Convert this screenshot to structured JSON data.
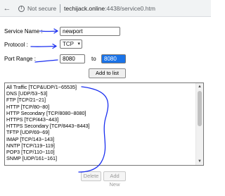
{
  "browser": {
    "security_text": "Not secure",
    "url_host": "techijack.online",
    "url_rest": ":4438/service0.htm",
    "icons": {
      "back": "back-arrow-icon",
      "warning": "info-warning-icon"
    }
  },
  "form": {
    "service_name_label": "Service Name :",
    "service_name_value": "newport",
    "protocol_label": "Protocol :",
    "protocol_value": "TCP",
    "port_range_label": "Port Range :",
    "port_start": "8080",
    "port_to_label": "to",
    "port_end": "8080",
    "add_button": "Add to list"
  },
  "service_list": [
    "All Traffic [TCP&UDP/1~65535]",
    "DNS [UDP/53~53]",
    "FTP [TCP/21~21]",
    "HTTP [TCP/80~80]",
    "HTTP Secondary [TCP/8080~8080]",
    "HTTPS [TCP/443~443]",
    "HTTPS Secondary [TCP/8443~8443]",
    "TFTP [UDP/69~69]",
    "IMAP [TCP/143~143]",
    "NNTP [TCP/119~119]",
    "POP3 [TCP/110~110]",
    "SNMP [UDP/161~161]"
  ],
  "list_actions": {
    "delete": "Delete",
    "add_new": "Add New"
  },
  "colors": {
    "annotation_ink": "#1a2ff0",
    "selection": "#1a73e8"
  }
}
